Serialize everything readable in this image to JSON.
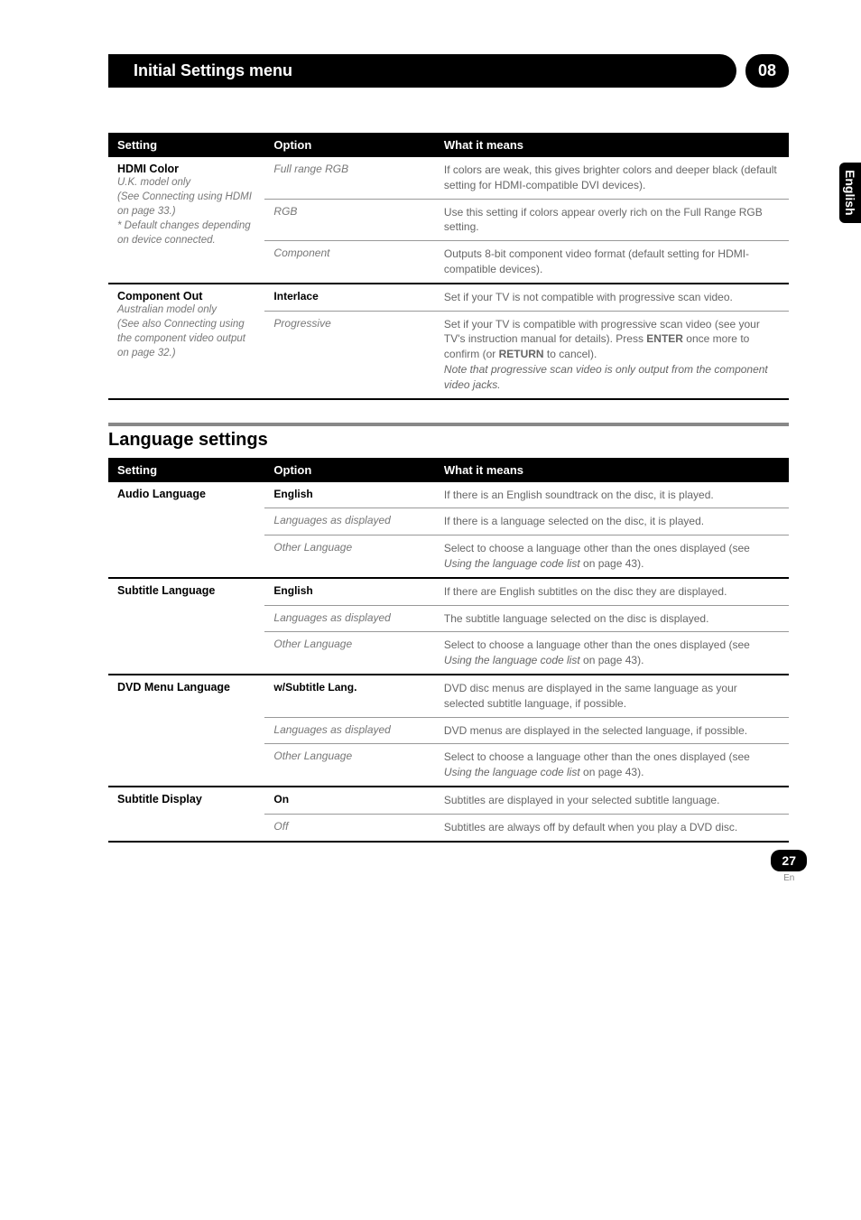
{
  "header": {
    "title": "Initial Settings menu",
    "chapter": "08"
  },
  "sideTab": "English",
  "table1": {
    "headers": [
      "Setting",
      "Option",
      "What it means"
    ],
    "groups": [
      {
        "setting_title": "HDMI Color",
        "setting_desc_lines": [
          "U.K. model only",
          "(See Connecting using HDMI on page 33.)",
          "* Default changes depending on device connected."
        ],
        "rows": [
          {
            "option": "Full range RGB",
            "option_style": "italic",
            "meaning": "If colors are weak, this gives brighter colors and deeper black (default setting for HDMI-compatible DVI devices)."
          },
          {
            "option": "RGB",
            "option_style": "italic",
            "meaning": "Use this setting if colors appear overly rich on the Full Range RGB setting."
          },
          {
            "option": "Component",
            "option_style": "italic",
            "meaning": "Outputs 8-bit component video format (default setting for HDMI-compatible devices)."
          }
        ]
      },
      {
        "setting_title": "Component Out",
        "setting_desc_lines": [
          "Australian model only",
          "(See also Connecting using the component video output on page 32.)"
        ],
        "rows": [
          {
            "option": "Interlace",
            "option_style": "bold",
            "meaning": "Set if your TV is not compatible with progressive scan video."
          },
          {
            "option": "Progressive",
            "option_style": "italic",
            "meaning_html": "Set if your TV is compatible with progressive scan video (see your TV's instruction manual for details). Press <b>ENTER</b> once more to confirm (or <b>RETURN</b> to cancel).<br><i>Note that progressive scan video is only output from the component video jacks.</i>"
          }
        ]
      }
    ]
  },
  "section2_title": "Language settings",
  "table2": {
    "headers": [
      "Setting",
      "Option",
      "What it means"
    ],
    "groups": [
      {
        "setting_title": "Audio Language",
        "rows": [
          {
            "option": "English",
            "option_style": "bold",
            "meaning": "If there is an English soundtrack on the disc, it is played."
          },
          {
            "option": "Languages as displayed",
            "option_style": "italic",
            "meaning": "If there is a language selected on the disc, it is played."
          },
          {
            "option": "Other Language",
            "option_style": "italic",
            "meaning_html": "Select to choose a language other than the ones displayed (see <i>Using the language code list</i> on page 43)."
          }
        ]
      },
      {
        "setting_title": "Subtitle Language",
        "rows": [
          {
            "option": "English",
            "option_style": "bold",
            "meaning": "If there are English subtitles on the disc they are displayed."
          },
          {
            "option": "Languages as displayed",
            "option_style": "italic",
            "meaning": "The subtitle language selected on the disc is displayed."
          },
          {
            "option": "Other Language",
            "option_style": "italic",
            "meaning_html": "Select to choose a language other than the ones displayed (see <i>Using the language code list</i> on page 43)."
          }
        ]
      },
      {
        "setting_title": "DVD Menu Language",
        "rows": [
          {
            "option": "w/Subtitle Lang.",
            "option_style": "bold",
            "meaning": "DVD disc menus are displayed in the same language as your selected subtitle language, if possible."
          },
          {
            "option": "Languages as displayed",
            "option_style": "italic",
            "meaning": "DVD menus are displayed in the selected language, if possible."
          },
          {
            "option": "Other Language",
            "option_style": "italic",
            "meaning_html": "Select to choose a language other than the ones displayed (see <i>Using the language code list</i> on page 43)."
          }
        ]
      },
      {
        "setting_title": "Subtitle Display",
        "rows": [
          {
            "option": "On",
            "option_style": "bold",
            "meaning": "Subtitles are displayed in your selected subtitle language."
          },
          {
            "option": "Off",
            "option_style": "italic",
            "meaning": "Subtitles are always off by default when you play a DVD disc."
          }
        ]
      }
    ]
  },
  "pageNumber": "27",
  "pageLabel": "En"
}
